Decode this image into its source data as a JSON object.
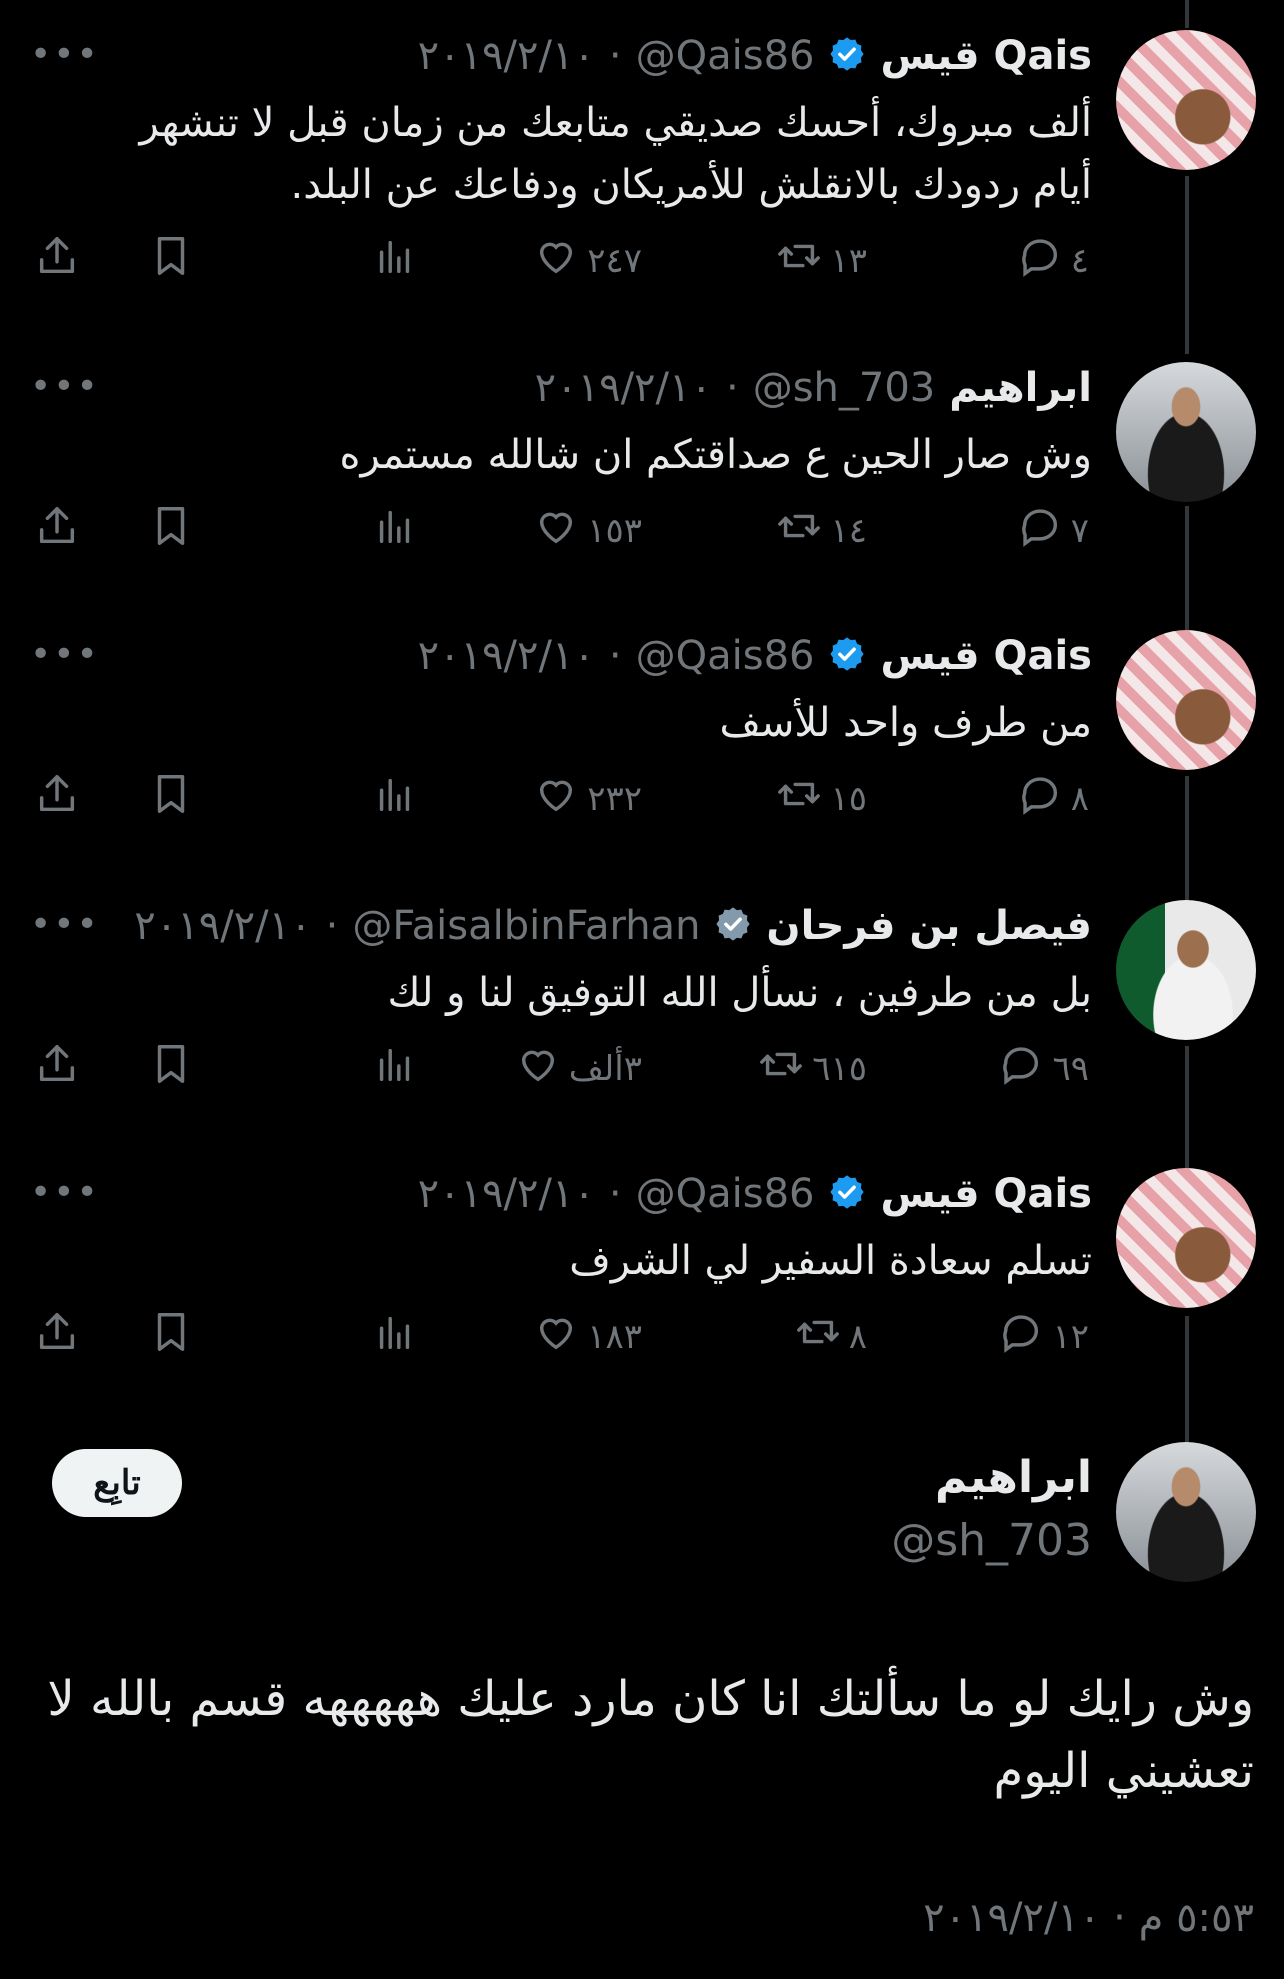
{
  "tweets": [
    {
      "display_name": "قيس Qais",
      "verified": true,
      "verified_color": "#1d9bf0",
      "handle": "@Qais86",
      "date": "٢٠١٩/٢/١٠",
      "text_lines": [
        "ألف مبروك، أحسك صديقي متابعك من زمان قبل لا تنشهر",
        "أيام ردودك بالانقلش للأمريكان ودفاعك عن البلد."
      ],
      "replies": "٤",
      "reposts": "١٣",
      "likes": "٢٤٧"
    },
    {
      "display_name": "ابراهيم",
      "verified": false,
      "handle": "@sh_703",
      "date": "٢٠١٩/٢/١٠",
      "text_lines": [
        "وش صار الحين ع صداقتكم ان شالله مستمره"
      ],
      "replies": "٧",
      "reposts": "١٤",
      "likes": "١٥٣"
    },
    {
      "display_name": "قيس Qais",
      "verified": true,
      "verified_color": "#1d9bf0",
      "handle": "@Qais86",
      "date": "٢٠١٩/٢/١٠",
      "text_lines": [
        "من طرف واحد للأسف"
      ],
      "replies": "٨",
      "reposts": "١٥",
      "likes": "٢٣٢"
    },
    {
      "display_name": "فيصل بن فرحان",
      "verified": true,
      "verified_color": "#829aab",
      "handle": "@FaisalbinFarhan",
      "date": "٢٠١٩/٢/١٠",
      "text_lines": [
        "بل من طرفين ، نسأل الله التوفيق لنا و لك"
      ],
      "replies": "٦٩",
      "reposts": "٦١٥",
      "likes": "٣ألف"
    },
    {
      "display_name": "قيس Qais",
      "verified": true,
      "verified_color": "#1d9bf0",
      "handle": "@Qais86",
      "date": "٢٠١٩/٢/١٠",
      "text_lines": [
        "تسلم سعادة السفير لي الشرف"
      ],
      "replies": "١٢",
      "reposts": "٨",
      "likes": "١٨٣"
    }
  ],
  "main": {
    "display_name": "ابراهيم",
    "handle": "@sh_703",
    "follow_label": "تابِع",
    "text_lines": [
      "وش رايك لو ما سألتك انا كان مارد عليك هههههه قسم بالله لا",
      "تعشيني اليوم"
    ],
    "timestamp": "٥:٥٣ م · ٢٠١٩/٢/١٠"
  },
  "more_label": "•••"
}
